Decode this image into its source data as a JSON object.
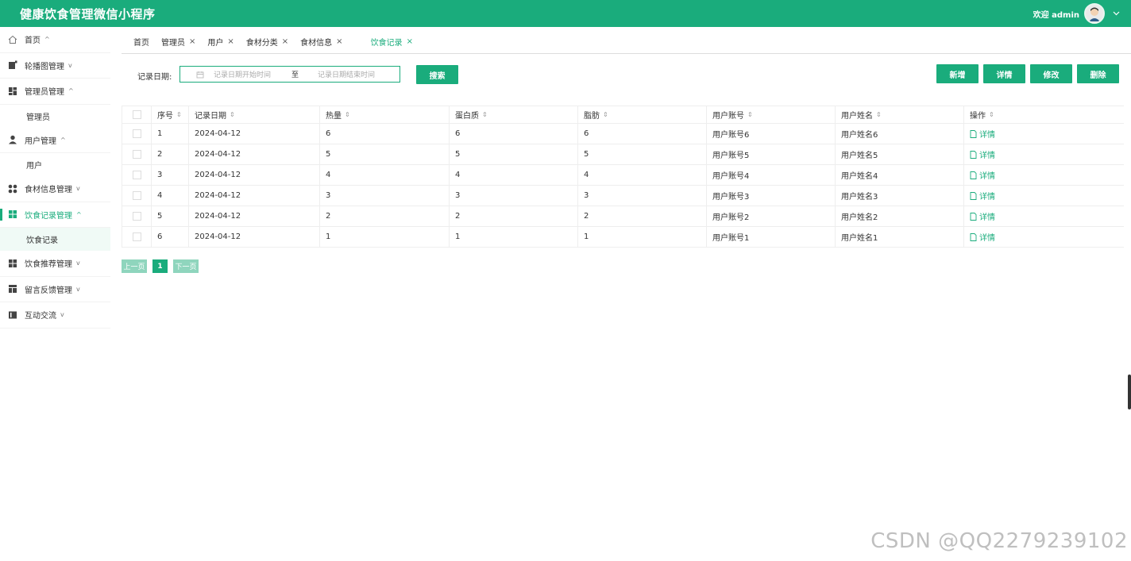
{
  "header": {
    "title": "健康饮食管理微信小程序",
    "welcome": "欢迎 admin"
  },
  "sidebar": {
    "items": [
      {
        "label": "首页",
        "arrow": "^"
      },
      {
        "label": "轮播图管理",
        "arrow": "v"
      },
      {
        "label": "管理员管理",
        "arrow": "^",
        "sub": "管理员"
      },
      {
        "label": "用户管理",
        "arrow": "^",
        "sub": "用户"
      },
      {
        "label": "食材信息管理",
        "arrow": "v"
      },
      {
        "label": "饮食记录管理",
        "arrow": "^",
        "sub": "饮食记录"
      },
      {
        "label": "饮食推荐管理",
        "arrow": "v"
      },
      {
        "label": "留言反馈管理",
        "arrow": "v"
      },
      {
        "label": "互动交流",
        "arrow": "v"
      }
    ]
  },
  "tabs": [
    {
      "label": "首页"
    },
    {
      "label": "管理员"
    },
    {
      "label": "用户"
    },
    {
      "label": "食材分类"
    },
    {
      "label": "食材信息"
    },
    {
      "label": "饮食记录"
    }
  ],
  "search": {
    "label": "记录日期:",
    "start_placeholder": "记录日期开始时间",
    "separator": "至",
    "end_placeholder": "记录日期结束时间",
    "button": "搜索"
  },
  "actions": {
    "add": "新增",
    "detail": "详情",
    "edit": "修改",
    "delete": "删除"
  },
  "table": {
    "columns": [
      "序号",
      "记录日期",
      "热量",
      "蛋白质",
      "脂肪",
      "用户账号",
      "用户姓名",
      "操作"
    ],
    "rows": [
      {
        "no": "1",
        "date": "2024-04-12",
        "calories": "6",
        "protein": "6",
        "fat": "6",
        "account": "用户账号6",
        "name": "用户姓名6",
        "op": "详情"
      },
      {
        "no": "2",
        "date": "2024-04-12",
        "calories": "5",
        "protein": "5",
        "fat": "5",
        "account": "用户账号5",
        "name": "用户姓名5",
        "op": "详情"
      },
      {
        "no": "3",
        "date": "2024-04-12",
        "calories": "4",
        "protein": "4",
        "fat": "4",
        "account": "用户账号4",
        "name": "用户姓名4",
        "op": "详情"
      },
      {
        "no": "4",
        "date": "2024-04-12",
        "calories": "3",
        "protein": "3",
        "fat": "3",
        "account": "用户账号3",
        "name": "用户姓名3",
        "op": "详情"
      },
      {
        "no": "5",
        "date": "2024-04-12",
        "calories": "2",
        "protein": "2",
        "fat": "2",
        "account": "用户账号2",
        "name": "用户姓名2",
        "op": "详情"
      },
      {
        "no": "6",
        "date": "2024-04-12",
        "calories": "1",
        "protein": "1",
        "fat": "1",
        "account": "用户账号1",
        "name": "用户姓名1",
        "op": "详情"
      }
    ]
  },
  "pagination": {
    "prev": "上一页",
    "current": "1",
    "next": "下一页"
  },
  "watermark": "CSDN @QQ2279239102",
  "colors": {
    "accent": "#1aac7c",
    "pager_light": "#8fd5bd"
  }
}
